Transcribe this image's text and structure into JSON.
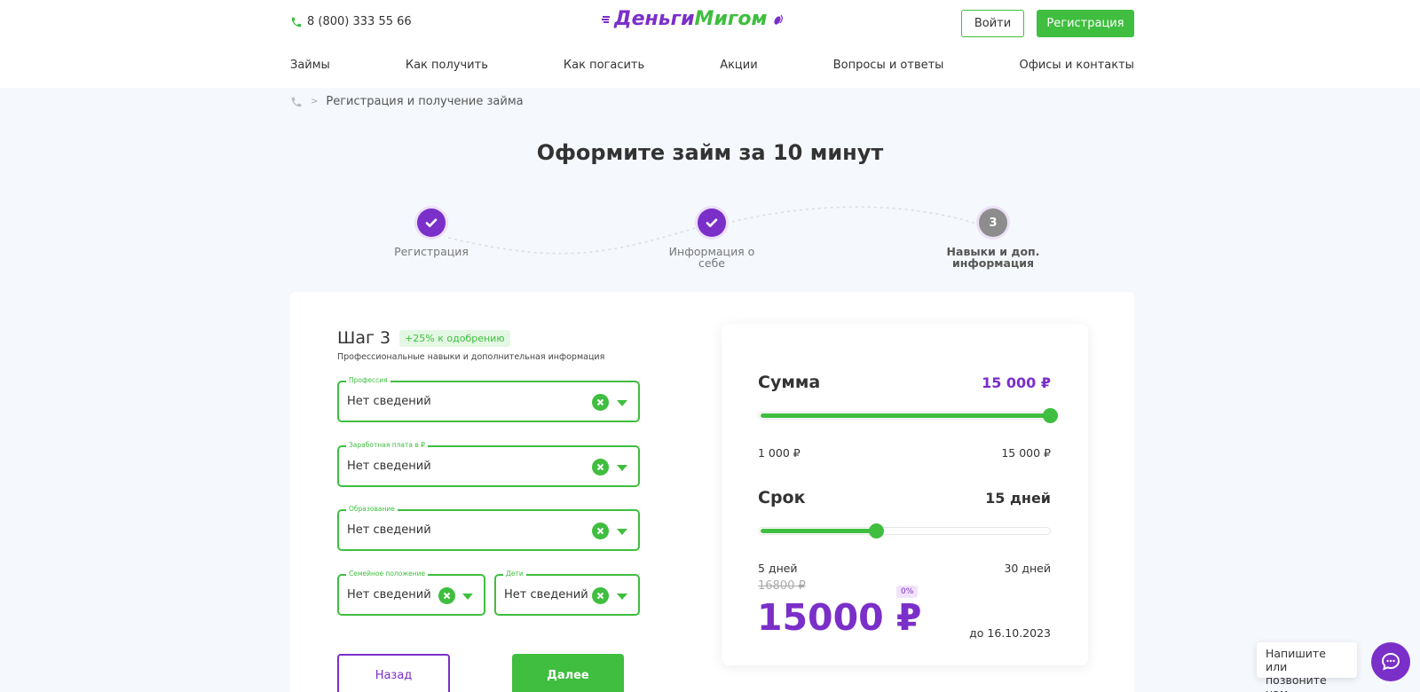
{
  "header": {
    "phone": "8 (800) 333 55 66",
    "logo_part1": "Деньги",
    "logo_part2": "Мигом",
    "login": "Войти",
    "register": "Регистрация"
  },
  "nav": [
    "Займы",
    "Как получить",
    "Как погасить",
    "Акции",
    "Вопросы и ответы",
    "Офисы и контакты"
  ],
  "breadcrumb": {
    "current": "Регистрация и получение займа"
  },
  "title": "Оформите займ за 10 минут",
  "steps": [
    {
      "label": "Регистрация",
      "status": "done"
    },
    {
      "label": "Информация о себе",
      "status": "done"
    },
    {
      "label": "Навыки и доп. информация",
      "number": "3",
      "status": "current"
    }
  ],
  "form": {
    "step_title": "Шаг 3",
    "badge": "+25% к одобрению",
    "subtitle": "Профессиональные навыки и дополнительная информация",
    "fields": {
      "profession": {
        "label": "Профессия",
        "value": "Нет сведений"
      },
      "salary": {
        "label": "Заработная плата в ₽",
        "value": "Нет сведений"
      },
      "education": {
        "label": "Образование",
        "value": "Нет сведений"
      },
      "marital": {
        "label": "Семейное положение",
        "value": "Нет сведений"
      },
      "children": {
        "label": "Дети",
        "value": "Нет сведений"
      }
    },
    "back": "Назад",
    "next": "Далее"
  },
  "calc": {
    "sum_label": "Сумма",
    "sum_value": "15 000 ₽",
    "sum_min": "1 000 ₽",
    "sum_max": "15 000 ₽",
    "sum_fraction": 1.0,
    "term_label": "Срок",
    "term_value": "15 дней",
    "term_min": "5 дней",
    "term_max": "30 дней",
    "term_fraction": 0.4,
    "old_price": "16800 ₽",
    "percent": "0%",
    "price": "15000 ₽",
    "until": "до 16.10.2023"
  },
  "chat": {
    "text": "Напишите или позвоните нам"
  },
  "colors": {
    "accent_green": "#3fbe3f",
    "accent_purple": "#7b2fc9"
  }
}
